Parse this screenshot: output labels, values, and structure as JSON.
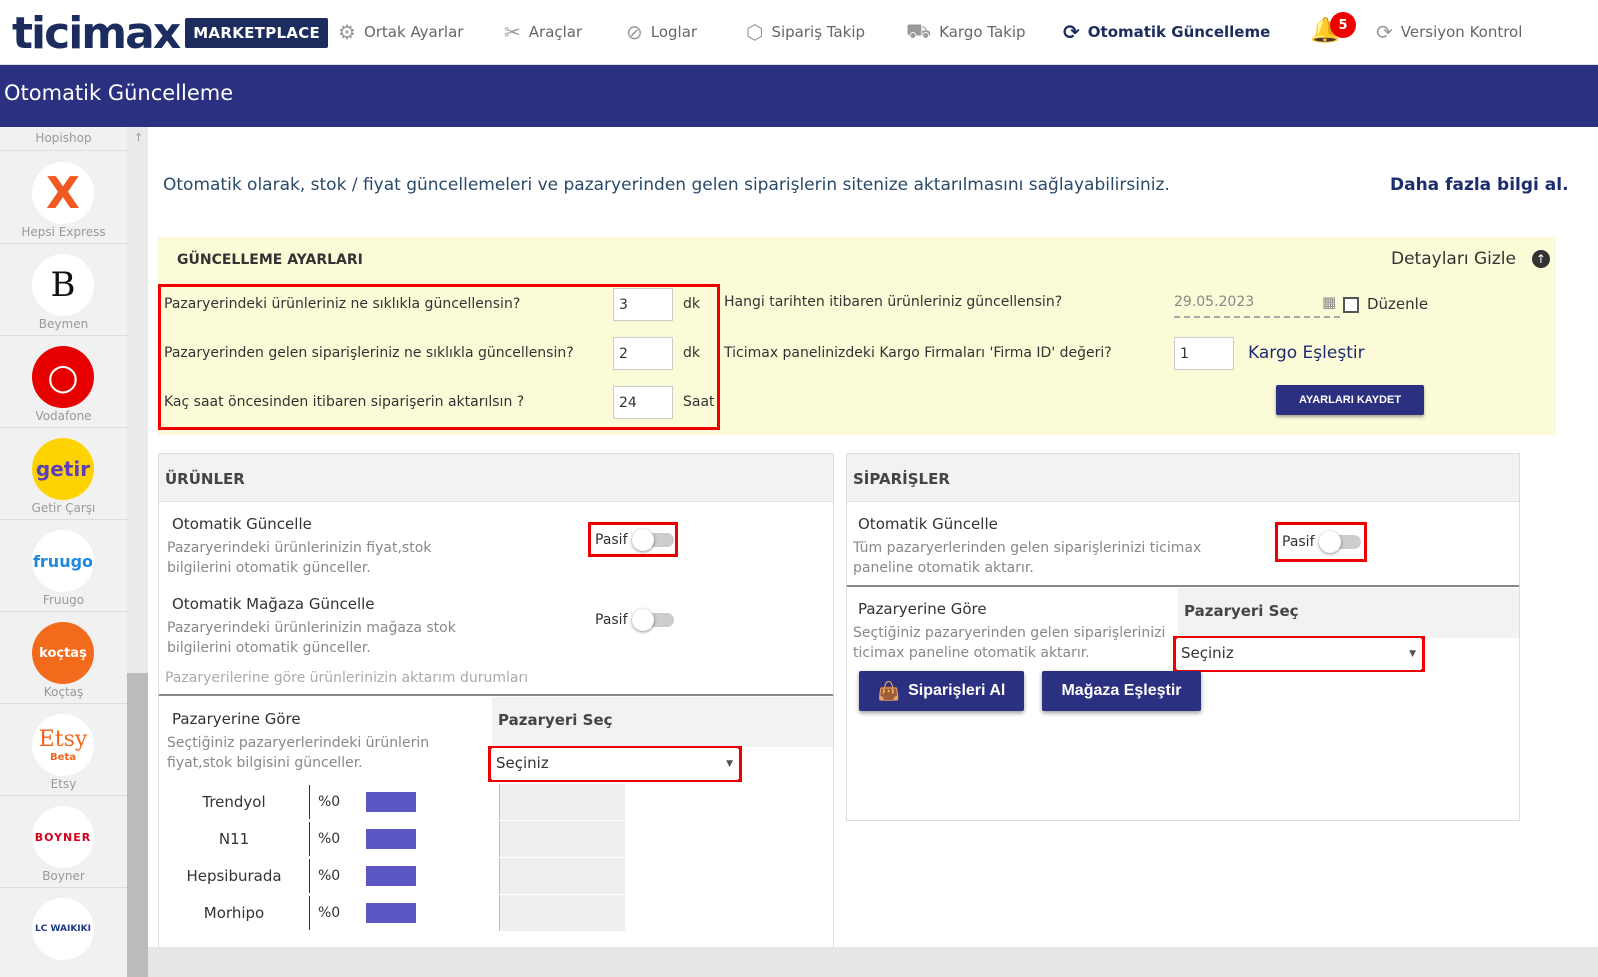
{
  "brand": {
    "logo": "ticimax",
    "badge": "MARKETPLACE",
    "color": "#1c2c5e"
  },
  "nav": {
    "items": [
      {
        "label": "Ortak Ayarlar",
        "icon": "gear-icon"
      },
      {
        "label": "Araçlar",
        "icon": "tools-icon"
      },
      {
        "label": "Loglar",
        "icon": "logs-icon"
      },
      {
        "label": "Sipariş Takip",
        "icon": "box-icon"
      },
      {
        "label": "Kargo Takip",
        "icon": "truck-icon"
      },
      {
        "label": "Otomatik Güncelleme",
        "icon": "sync-icon",
        "active": true
      },
      {
        "label": "Versiyon Kontrol",
        "icon": "sync-icon"
      }
    ],
    "notification_count": "5"
  },
  "page_title": "Otomatik Güncelleme",
  "sidebar": {
    "items": [
      {
        "label": "Hopishop"
      },
      {
        "label": "Hepsi Express",
        "mark": "X"
      },
      {
        "label": "Beymen",
        "mark": "B"
      },
      {
        "label": "Vodafone",
        "mark": "○"
      },
      {
        "label": "Getir Çarşı",
        "mark": "getir"
      },
      {
        "label": "Fruugo",
        "mark": "fruugo"
      },
      {
        "label": "Koçtaş",
        "mark": "koçtaş"
      },
      {
        "label": "Etsy",
        "mark": "Etsy",
        "sub": "Beta"
      },
      {
        "label": "Boyner",
        "mark": "BOYNER"
      },
      {
        "label": "",
        "mark": "LC WAIKIKI"
      }
    ]
  },
  "intro": {
    "text": "Otomatik olarak, stok / fiyat güncellemeleri ve pazaryerinden gelen siparişlerin sitenize aktarılmasını sağlayabilirsiniz.",
    "more_link": "Daha fazla bilgi al."
  },
  "settings": {
    "title": "GÜNCELLEME AYARLARI",
    "hide_details": "Detayları Gizle",
    "rows": [
      {
        "label": "Pazaryerindeki ürünleriniz ne sıklıkla güncellensin?",
        "value": "3",
        "unit": "dk"
      },
      {
        "label": "Pazaryerinden gelen siparişleriniz ne sıklıkla güncellensin?",
        "value": "2",
        "unit": "dk"
      },
      {
        "label": "Kaç saat öncesinden itibaren siparişerin aktarılsın ?",
        "value": "24",
        "unit": "Saat"
      }
    ],
    "date_label": "Hangi tarihten itibaren ürünleriniz güncellensin?",
    "date_value": "29.05.2023",
    "edit_label": "Düzenle",
    "firm_id_label": "Ticimax panelinizdeki Kargo Firmaları 'Firma ID' değeri?",
    "firm_id_value": "1",
    "kargo_link": "Kargo Eşleştir",
    "save_label": "AYARLARI KAYDET"
  },
  "products": {
    "title": "ÜRÜNLER",
    "auto_update": {
      "title": "Otomatik Güncelle",
      "desc1": "Pazaryerindeki ürünlerinizin fiyat,stok",
      "desc2": "bilgilerini otomatik günceller.",
      "status": "Pasif"
    },
    "store_update": {
      "title": "Otomatik Mağaza Güncelle",
      "desc1": "Pazaryerindeki ürünlerinizin mağaza stok",
      "desc2": "bilgilerini otomatik günceller.",
      "status": "Pasif"
    },
    "transfer_status": "Pazaryerilerine göre ürünlerinizin aktarım durumları",
    "by_marketplace": {
      "title": "Pazaryerine Göre",
      "desc1": "Seçtiğiniz pazaryerlerindeki ürünlerin",
      "desc2": "fiyat,stok bilgisini günceller.",
      "select_head": "Pazaryeri Seç",
      "select_value": "Seçiniz"
    },
    "marketplaces": [
      {
        "name": "Trendyol",
        "pct": "%0"
      },
      {
        "name": "N11",
        "pct": "%0"
      },
      {
        "name": "Hepsiburada",
        "pct": "%0"
      },
      {
        "name": "Morhipo",
        "pct": "%0"
      }
    ]
  },
  "orders": {
    "title": "SİPARİŞLER",
    "auto_update": {
      "title": "Otomatik Güncelle",
      "desc1": "Tüm pazaryerlerinden gelen siparişlerinizi ticimax",
      "desc2": "paneline otomatik aktarır.",
      "status": "Pasif"
    },
    "by_marketplace": {
      "title": "Pazaryerine Göre",
      "desc1": "Seçtiğiniz pazaryerinden gelen siparişlerinizi",
      "desc2": "ticimax paneline otomatik aktarır.",
      "select_head": "Pazaryeri Seç",
      "select_value": "Seçiniz"
    },
    "get_orders": "Siparişleri Al",
    "match_store": "Mağaza Eşleştir"
  }
}
